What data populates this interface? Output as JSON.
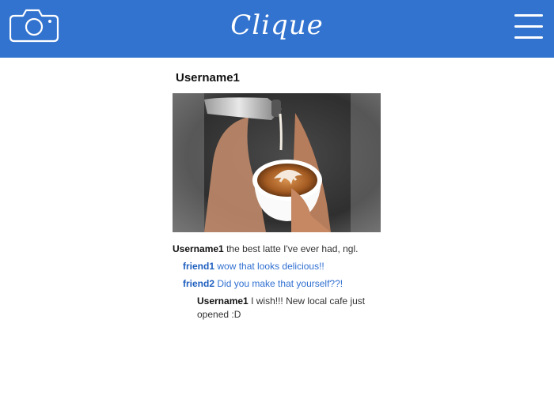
{
  "header": {
    "brand": "Clique",
    "camera_icon": "camera-icon",
    "menu_icon": "hamburger-menu-icon",
    "background": "#3273CF"
  },
  "post": {
    "username": "Username1",
    "image_subject": "latte-art-pour",
    "comments": [
      {
        "user": "Username1",
        "text": "the best latte I've ever had, ngl."
      },
      {
        "user": "friend1",
        "text": "wow that looks delicious!!"
      },
      {
        "user": "friend2",
        "text": "Did you make that yourself??!"
      },
      {
        "user": "Username1",
        "text": "I wish!!! New local cafe just opened :D"
      }
    ]
  }
}
